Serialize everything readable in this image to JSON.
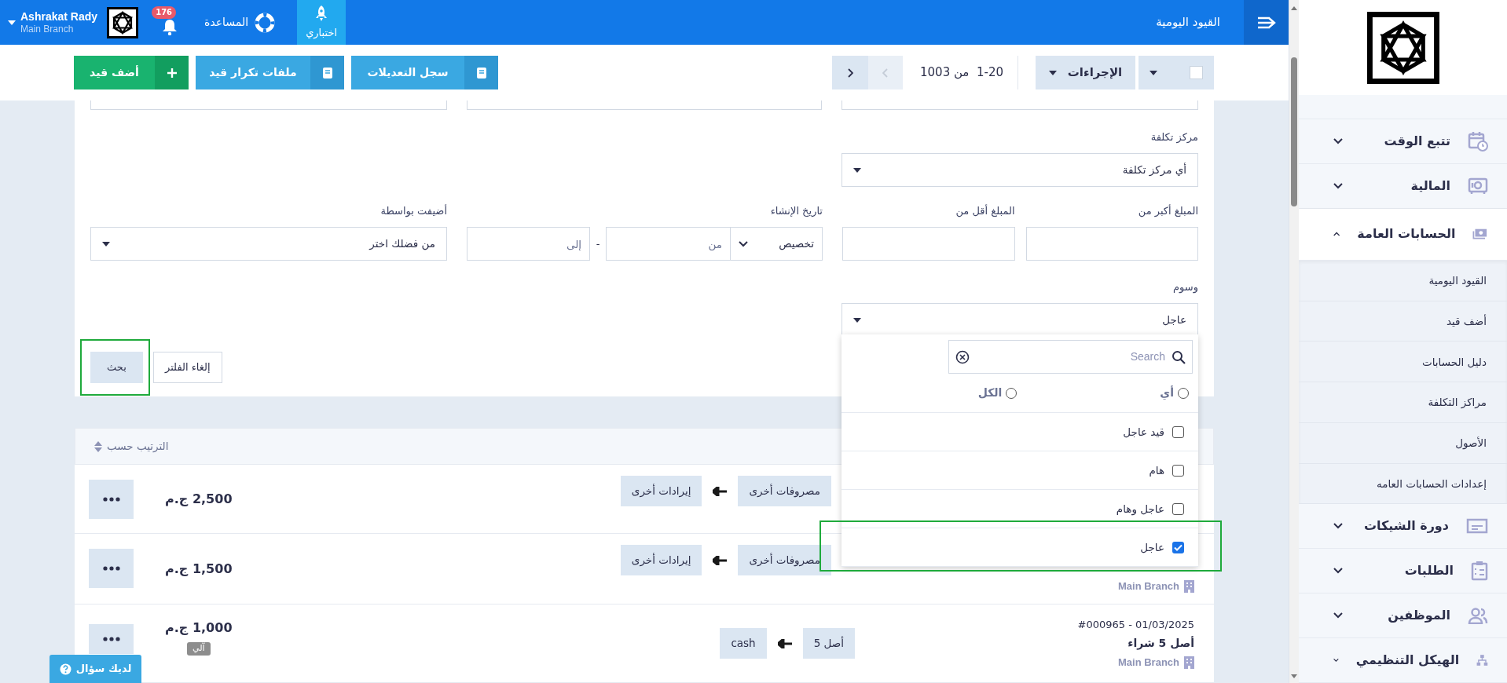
{
  "top_bar": {
    "title": "القيود اليومية",
    "apps": [
      {
        "kind": "test",
        "label": "اختباري",
        "selected": true
      },
      {
        "kind": "help",
        "label": "المساعدة",
        "selected": false
      }
    ],
    "notifications": {
      "count": "176"
    },
    "user": {
      "name": "Ashrakat Rady",
      "branch": "Main Branch"
    }
  },
  "toolbar": {
    "select_all": {
      "checked": false
    },
    "actions_label": "الإجراءات",
    "range": "1-20  من 1003",
    "prev_disabled": true,
    "next_disabled": false,
    "buttons": [
      {
        "kind": "log",
        "label": "سجل التعديلات"
      },
      {
        "kind": "recurring",
        "label": "ملفات تكرار قيد"
      },
      {
        "kind": "add",
        "label": "أضف قيد"
      }
    ]
  },
  "filters": {
    "cost_center": {
      "label": "مركز تكلفة",
      "value": "أي مركز تكلفة"
    },
    "amount_min": {
      "label": "المبلغ أكبر من"
    },
    "amount_max": {
      "label": "المبلغ أقل من"
    },
    "created": {
      "label": "تاريخ الإنشاء",
      "mode": "تخصيص",
      "from_placeholder": "من",
      "to_placeholder": "إلى",
      "separator": "-"
    },
    "added_by": {
      "label": "أضيفت بواسطة",
      "value": "من فضلك اختر"
    },
    "tags": {
      "label": "وسوم",
      "value": "عاجل",
      "dropdown": {
        "search_placeholder": "Search",
        "match_options": [
          {
            "label": "أي",
            "selected": false
          },
          {
            "label": "الكل",
            "selected": false
          }
        ],
        "options": [
          {
            "label": "قيد عاجل",
            "checked": false
          },
          {
            "label": "هام",
            "checked": false
          },
          {
            "label": "عاجل وهام",
            "checked": false
          },
          {
            "label": "عاجل",
            "checked": true
          }
        ]
      }
    },
    "search_button": "بحث",
    "clear_button": "إلغاء الفلتر"
  },
  "list": {
    "sort_label": "الترتيب حسب",
    "rows": [
      {
        "from": "مصروفات أخرى",
        "to": "إيرادات أخرى",
        "amount": "2,500 ج.م"
      },
      {
        "branch": "Main Branch",
        "from": "مصروفات أخرى",
        "to": "إيرادات أخرى",
        "amount": "1,500 ج.م"
      },
      {
        "date": "01/03/2025 - #000965",
        "title": "أصل 5 شراء",
        "branch": "Main Branch",
        "from": "أصل 5",
        "to": "cash",
        "amount": "1,000 ج.م",
        "badge": "آلي"
      }
    ]
  },
  "help_button": "لديك سؤال",
  "sidebar": {
    "items": [
      {
        "kind": "calendar",
        "label": "تتبع الوقت",
        "expanded": false
      },
      {
        "kind": "safe",
        "label": "المالية",
        "expanded": false
      },
      {
        "kind": "money",
        "label": "الحسابات العامة",
        "expanded": true,
        "children": [
          {
            "label": "القيود اليومية"
          },
          {
            "label": "أضف قيد"
          },
          {
            "label": "دليل الحسابات"
          },
          {
            "label": "مراكز التكلفة"
          },
          {
            "label": "الأصول"
          },
          {
            "label": "إعدادات الحسابات العامه"
          }
        ]
      },
      {
        "kind": "card",
        "label": "دورة الشيكات",
        "expanded": false
      },
      {
        "kind": "clipboard",
        "label": "الطلبات",
        "expanded": false
      },
      {
        "kind": "people",
        "label": "الموظفين",
        "expanded": false
      },
      {
        "kind": "org",
        "label": "الهيكل التنظيمي",
        "expanded": false
      }
    ]
  }
}
